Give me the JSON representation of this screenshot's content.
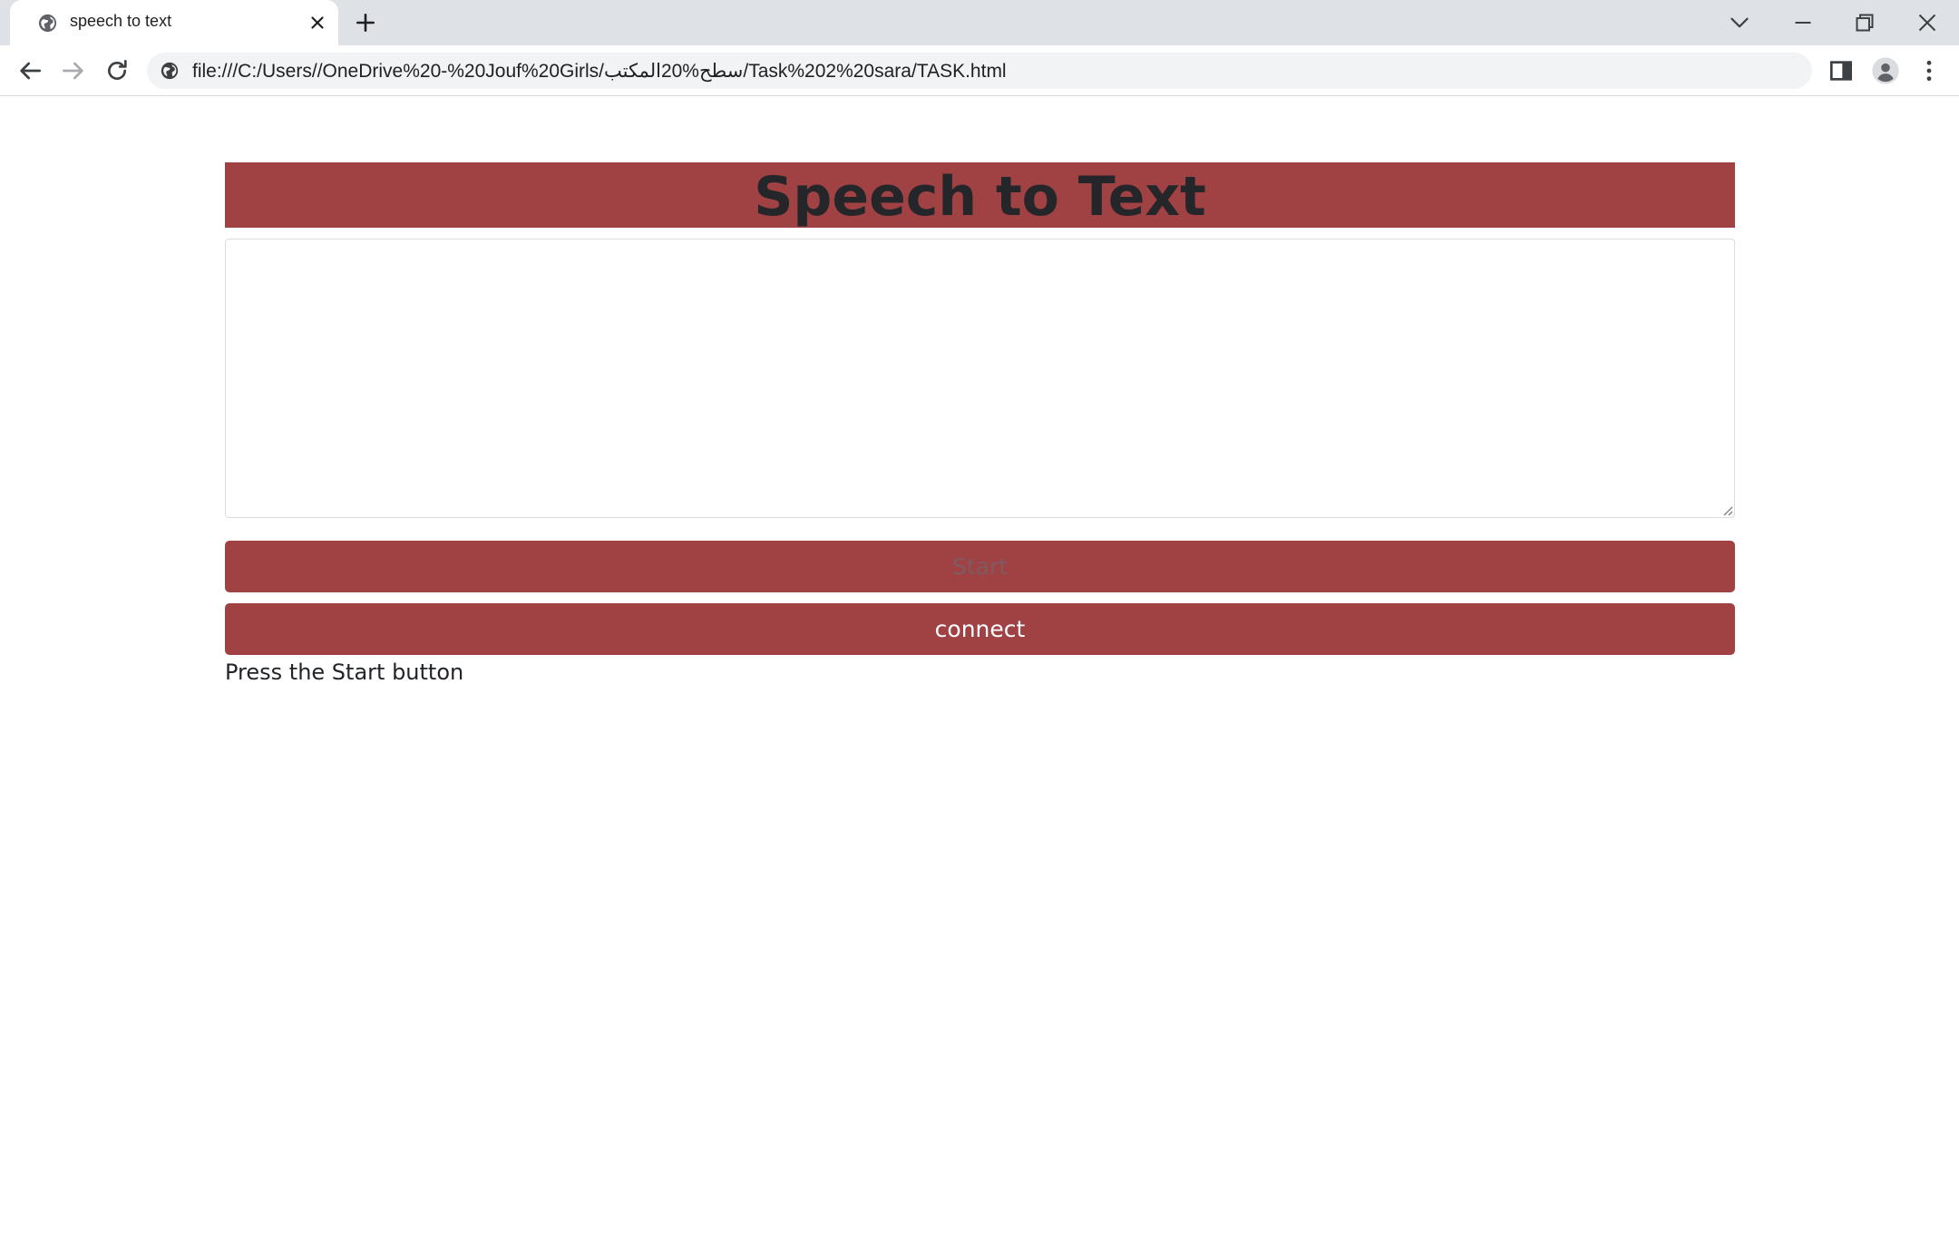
{
  "browser": {
    "tab_title": "speech to text",
    "url": "file:///C:/Users//OneDrive%20-%20Jouf%20Girls/سطح%20المكتب/Task%202%20sara/TASK.html"
  },
  "page": {
    "title": "Speech to Text",
    "transcript_value": "",
    "start_label": "Start",
    "connect_label": "connect",
    "status_text": "Press the Start button"
  },
  "colors": {
    "accent": "#a04144",
    "tabstrip": "#dee1e6",
    "omnibox": "#f1f3f4"
  }
}
